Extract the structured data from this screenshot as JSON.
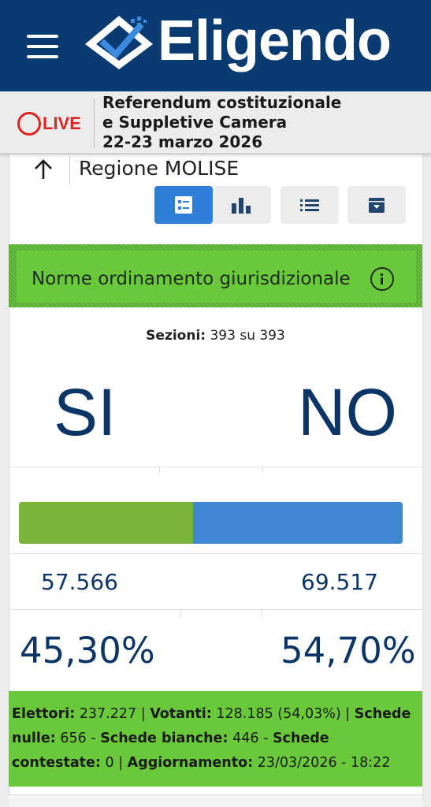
{
  "header": {
    "logo_text": "Eligendo",
    "colors": {
      "header_bg": "#0a3a72",
      "live_red": "#e02222"
    }
  },
  "live": {
    "label": "LIVE",
    "title_lines": [
      "Referendum costituzionale",
      "e Suppletive Camera",
      "22-23 marzo 2026"
    ]
  },
  "nav": {
    "region": "Regione MOLISE",
    "view_buttons": [
      {
        "icon": "list-card-icon",
        "active": true
      },
      {
        "icon": "bar-chart-icon",
        "active": false
      },
      {
        "icon": "bullet-list-icon",
        "active": false
      },
      {
        "icon": "archive-download-icon",
        "active": false
      }
    ]
  },
  "question": {
    "title": "Norme ordinamento giurisdizionale",
    "colors": {
      "band": "#6ac93a"
    }
  },
  "results": {
    "sezioni_label": "Sezioni:",
    "sezioni_value": "393 su 393",
    "si_label": "SI",
    "no_label": "NO",
    "si_votes": "57.566",
    "no_votes": "69.517",
    "si_pct": "45,30%",
    "no_pct": "54,70%",
    "si_share": 0.453,
    "no_share": 0.547,
    "colors": {
      "si": "#7bb43a",
      "no": "#3f86d3",
      "text": "#0b3566"
    }
  },
  "stats": {
    "elettori_label": "Elettori:",
    "elettori_value": "237.227",
    "votanti_label": "Votanti:",
    "votanti_value": "128.185 (54,03%)",
    "nulle_label": "Schede nulle:",
    "nulle_value": "656",
    "bianche_label": "Schede bianche:",
    "bianche_value": "446",
    "contestate_label": "Schede contestate:",
    "contestate_value": "0",
    "aggiornamento_label": "Aggiornamento:",
    "aggiornamento_value": "23/03/2026 - 18:22"
  }
}
